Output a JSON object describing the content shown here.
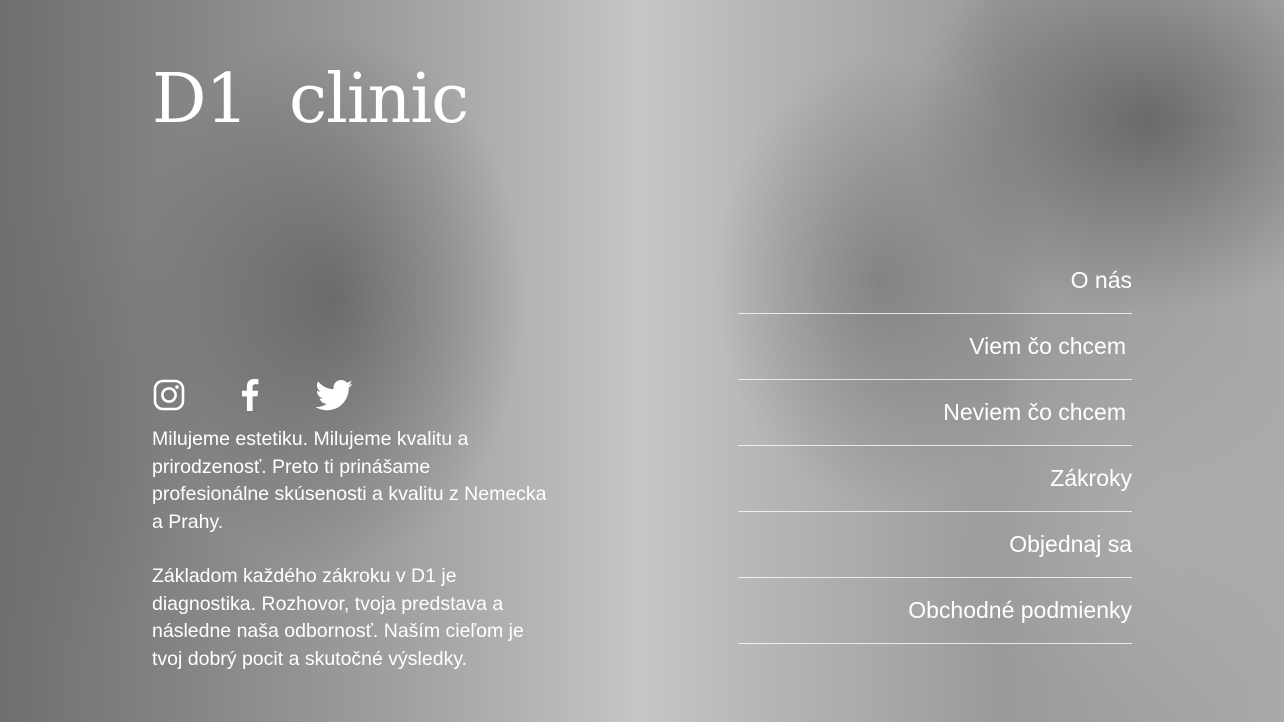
{
  "brand": {
    "logo_text": "D1  clinic"
  },
  "social": {
    "icons": [
      "instagram-icon",
      "facebook-icon",
      "twitter-icon"
    ]
  },
  "intro": {
    "paragraph_1": "Milujeme estetiku. Milujeme kvalitu a prirodzenosť. Preto ti prinášame profesionálne skúsenosti a kvalitu z Nemecka a Prahy.",
    "paragraph_2": "Základom každého zákroku v D1 je diagnostika. Rozhovor, tvoja predstava a následne naša odbornosť. Naším cieľom je tvoj dobrý pocit a skutočné výsledky."
  },
  "nav": {
    "items": [
      {
        "label": "O nás"
      },
      {
        "label": "Viem čo chcem"
      },
      {
        "label": "Neviem čo chcem"
      },
      {
        "label": "Zákroky"
      },
      {
        "label": "Objednaj sa"
      },
      {
        "label": "Obchodné podmienky"
      }
    ]
  },
  "colors": {
    "text": "#ffffff",
    "background": "#b5b5b5"
  }
}
